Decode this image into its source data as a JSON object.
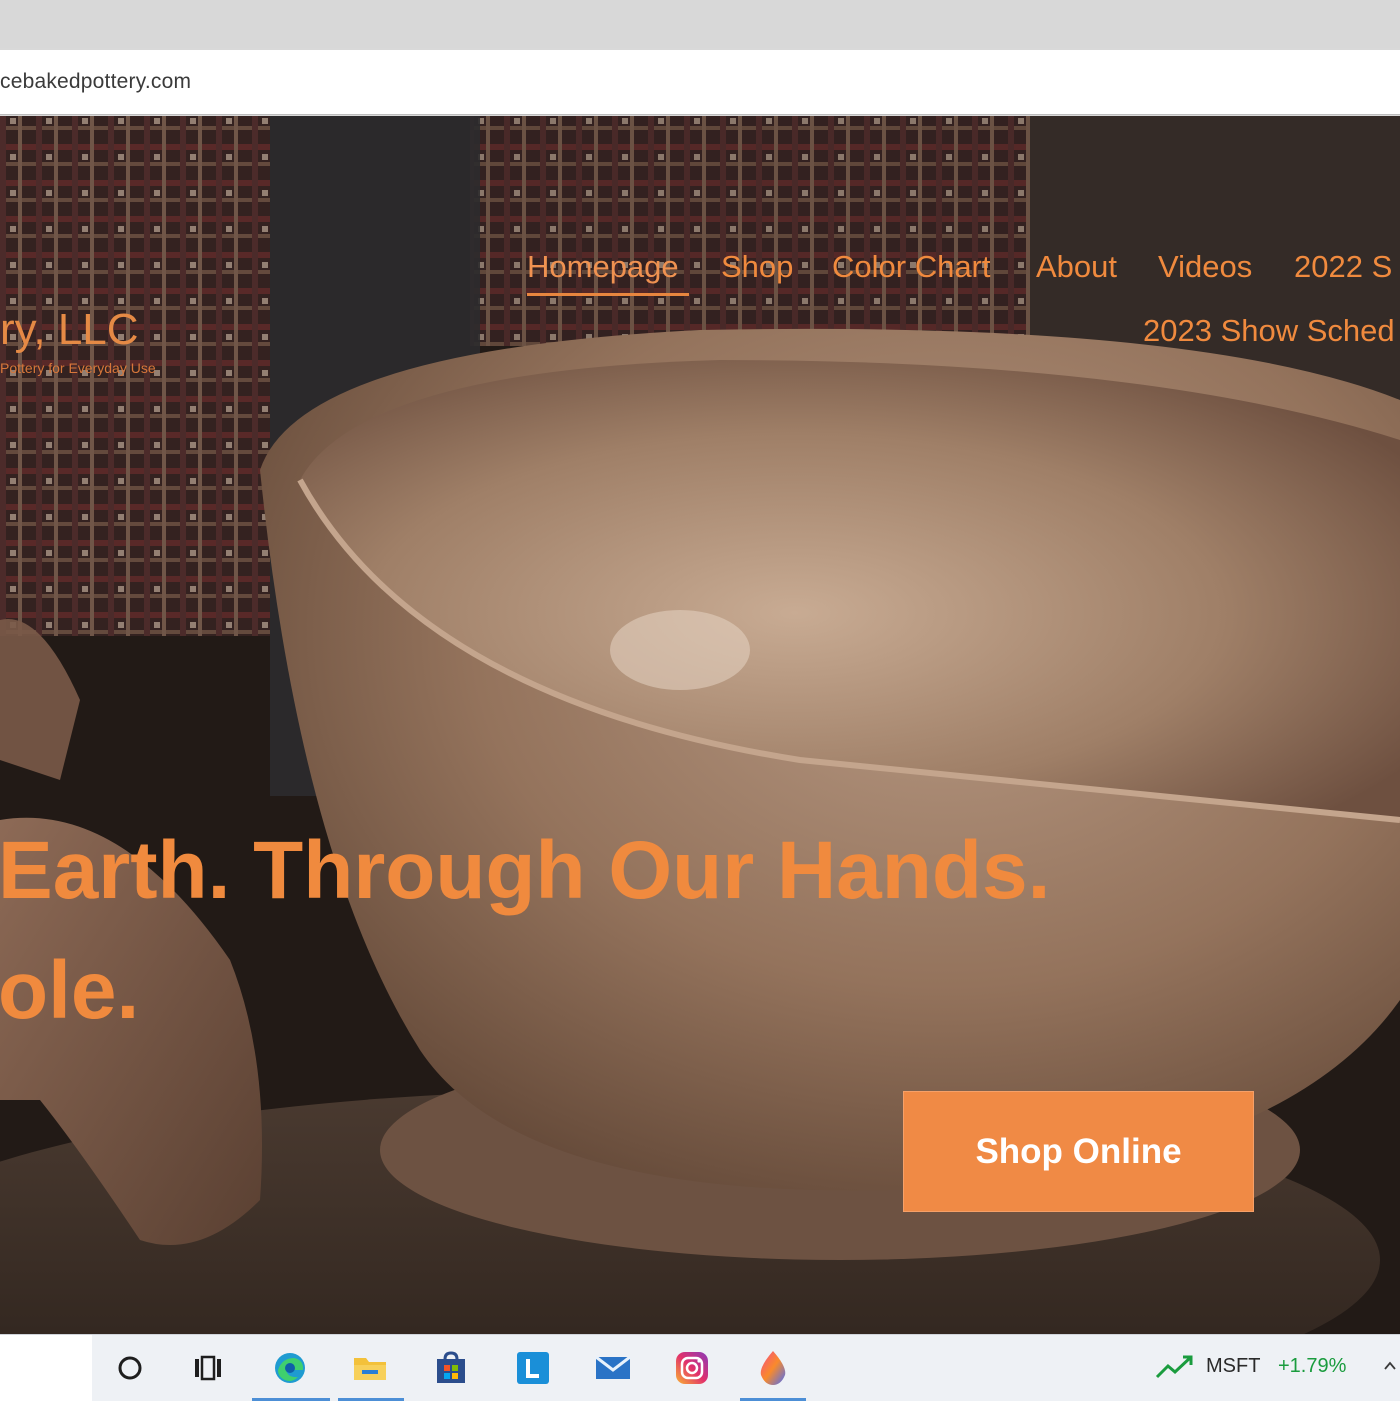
{
  "browser": {
    "url": "cebakedpottery.com"
  },
  "site": {
    "brand": "ry, LLC",
    "tagline": "Pottery for Everyday Use",
    "nav": {
      "row1": [
        "Homepage",
        "Shop",
        "Color Chart",
        "About",
        "Videos",
        "2022 S"
      ],
      "row2": "2023 Show Sched",
      "active": "Homepage"
    },
    "headline_line1": "Earth. Through Our Hands.",
    "headline_line2": "ole.",
    "cta_label": "Shop Online"
  },
  "colors": {
    "accent": "#f08a3e",
    "cta_bg": "#f08a45",
    "taskbar_bg": "#eef1f5",
    "stock_green": "#1a9c3e"
  },
  "taskbar": {
    "icons": [
      "cortana-icon",
      "task-view-icon",
      "edge-icon",
      "file-explorer-icon",
      "microsoft-store-icon",
      "l-app-icon",
      "mail-icon",
      "instagram-icon",
      "paint-drop-icon"
    ],
    "stock": {
      "ticker": "MSFT",
      "change": "+1.79%"
    }
  }
}
